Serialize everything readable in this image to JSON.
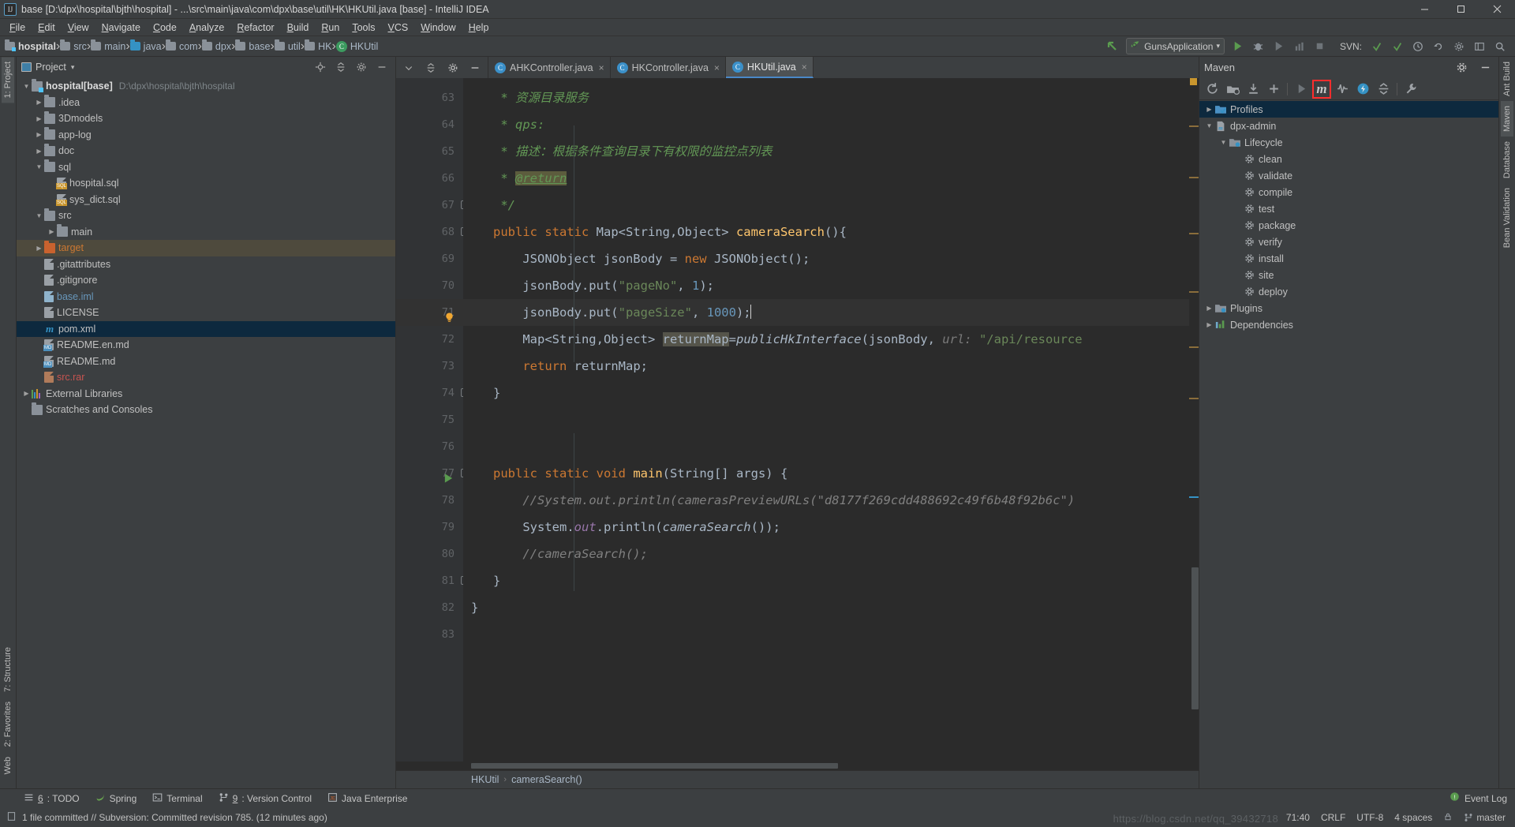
{
  "window": {
    "title": "base [D:\\dpx\\hospital\\bjth\\hospital] - ...\\src\\main\\java\\com\\dpx\\base\\util\\HK\\HKUtil.java [base] - IntelliJ IDEA",
    "logo": "IJ",
    "minimize_icon": "minimize-icon",
    "maximize_icon": "maximize-icon",
    "close_icon": "close-icon"
  },
  "menu": [
    "File",
    "Edit",
    "View",
    "Navigate",
    "Code",
    "Analyze",
    "Refactor",
    "Build",
    "Run",
    "Tools",
    "VCS",
    "Window",
    "Help"
  ],
  "breadcrumb": {
    "items": [
      "hospital",
      "src",
      "main",
      "java",
      "com",
      "dpx",
      "base",
      "util",
      "HK",
      "HKUtil"
    ],
    "separator": "›"
  },
  "toolbar": {
    "back_icon": "back-arrow-icon",
    "run_config": "GunsApplication",
    "run_config_caret": "▾",
    "run_icon": "run-icon",
    "debug_icon": "debug-icon",
    "coverage_icon": "run-with-coverage-icon",
    "profiler_icon": "profiler-icon",
    "stop_icon": "stop-icon",
    "svn_label": "SVN:",
    "svn_update_icon": "svn-update-icon",
    "svn_commit_icon": "svn-commit-icon",
    "history_icon": "history-icon",
    "rollback_icon": "rollback-icon",
    "settings_icon": "settings-icon",
    "layout_icon": "layout-icon",
    "search_icon": "search-icon"
  },
  "left_stripe": {
    "top": [
      {
        "label": "1: Project",
        "active": true
      }
    ],
    "bottom": [
      {
        "label": "7: Structure",
        "active": false
      },
      {
        "label": "2: Favorites",
        "active": false
      },
      {
        "label": "Web",
        "active": false
      }
    ]
  },
  "right_stripe": [
    {
      "label": "Ant Build",
      "active": false
    },
    {
      "label": "Maven",
      "active": true
    },
    {
      "label": "Database",
      "active": false
    },
    {
      "label": "Bean Validation",
      "active": false
    }
  ],
  "project_panel": {
    "title": "Project",
    "caret": "▾",
    "locate_icon": "locate-file-icon",
    "collapse_icon": "collapse-all-icon",
    "gear_icon": "gear-icon",
    "hide_icon": "hide-panel-icon",
    "tree": [
      {
        "depth": 0,
        "arrow": "▼",
        "icon": "folder-module",
        "name": "hospital",
        "bold_suffix": "[base]",
        "path": "D:\\dpx\\hospital\\bjth\\hospital",
        "style": "bold"
      },
      {
        "depth": 1,
        "arrow": "▶",
        "icon": "folder",
        "name": ".idea",
        "style": ""
      },
      {
        "depth": 1,
        "arrow": "▶",
        "icon": "folder",
        "name": "3Dmodels",
        "style": ""
      },
      {
        "depth": 1,
        "arrow": "▶",
        "icon": "folder",
        "name": "app-log",
        "style": ""
      },
      {
        "depth": 1,
        "arrow": "▶",
        "icon": "folder",
        "name": "doc",
        "style": ""
      },
      {
        "depth": 1,
        "arrow": "▼",
        "icon": "folder",
        "name": "sql",
        "style": ""
      },
      {
        "depth": 2,
        "arrow": "",
        "icon": "sql-file",
        "name": "hospital.sql",
        "style": ""
      },
      {
        "depth": 2,
        "arrow": "",
        "icon": "sql-file",
        "name": "sys_dict.sql",
        "style": ""
      },
      {
        "depth": 1,
        "arrow": "▼",
        "icon": "folder",
        "name": "src",
        "style": ""
      },
      {
        "depth": 2,
        "arrow": "▶",
        "icon": "folder",
        "name": "main",
        "style": ""
      },
      {
        "depth": 1,
        "arrow": "▶",
        "icon": "folder-orange",
        "name": "target",
        "style": "orange",
        "row": "highlight"
      },
      {
        "depth": 1,
        "arrow": "",
        "icon": "file",
        "name": ".gitattributes",
        "style": ""
      },
      {
        "depth": 1,
        "arrow": "",
        "icon": "file",
        "name": ".gitignore",
        "style": ""
      },
      {
        "depth": 1,
        "arrow": "",
        "icon": "iml-file",
        "name": "base.iml",
        "style": "blue"
      },
      {
        "depth": 1,
        "arrow": "",
        "icon": "file",
        "name": "LICENSE",
        "style": ""
      },
      {
        "depth": 1,
        "arrow": "",
        "icon": "maven-file",
        "name": "pom.xml",
        "style": "",
        "row": "selected"
      },
      {
        "depth": 1,
        "arrow": "",
        "icon": "md-file",
        "name": "README.en.md",
        "style": ""
      },
      {
        "depth": 1,
        "arrow": "",
        "icon": "md-file",
        "name": "README.md",
        "style": ""
      },
      {
        "depth": 1,
        "arrow": "",
        "icon": "rar-file",
        "name": "src.rar",
        "style": "red"
      },
      {
        "depth": 0,
        "arrow": "▶",
        "icon": "libraries",
        "name": "External Libraries",
        "style": ""
      },
      {
        "depth": 0,
        "arrow": "",
        "icon": "scratches",
        "name": "Scratches and Consoles",
        "style": ""
      }
    ]
  },
  "editor": {
    "tabs": [
      {
        "label": "AHKController.java",
        "active": false,
        "close": "×"
      },
      {
        "label": "HKController.java",
        "active": false,
        "close": "×"
      },
      {
        "label": "HKUtil.java",
        "active": true,
        "close": "×"
      }
    ],
    "tab_icon": "java-class-icon",
    "left_actions": [
      "expand-icon",
      "settings-icon",
      "hide-icon"
    ],
    "first_line_number": 63,
    "lines": [
      {
        "n": 63,
        "fold": "",
        "text": "    * 资源目录服务"
      },
      {
        "n": 64,
        "fold": "",
        "text": "    * qps:"
      },
      {
        "n": 65,
        "fold": "",
        "text": "    * 描述：根据条件查询目录下有权限的监控点列表"
      },
      {
        "n": 66,
        "fold": "",
        "text": "    * @return"
      },
      {
        "n": 67,
        "fold": "open",
        "text": "    */"
      },
      {
        "n": 68,
        "fold": "open",
        "text": "   public static Map<String,Object> cameraSearch(){"
      },
      {
        "n": 69,
        "fold": "",
        "text": "       JSONObject jsonBody = new JSONObject();"
      },
      {
        "n": 70,
        "fold": "",
        "text": "       jsonBody.put(\"pageNo\", 1);"
      },
      {
        "n": 71,
        "fold": "",
        "text": "       jsonBody.put(\"pageSize\", 1000);",
        "bulb": true,
        "current": true
      },
      {
        "n": 72,
        "fold": "",
        "text": "       Map<String,Object> returnMap=publicHkInterface(jsonBody, url: \"/api/resource"
      },
      {
        "n": 73,
        "fold": "",
        "text": "       return returnMap;"
      },
      {
        "n": 74,
        "fold": "open",
        "text": "   }"
      },
      {
        "n": 75,
        "fold": "",
        "text": ""
      },
      {
        "n": 76,
        "fold": "",
        "text": ""
      },
      {
        "n": 77,
        "fold": "open",
        "text": "   public static void main(String[] args) {",
        "run": true
      },
      {
        "n": 78,
        "fold": "",
        "text": "       //System.out.println(camerasPreviewURLs(\"d8177f269cdd488692c49f6b48f92b6c\")"
      },
      {
        "n": 79,
        "fold": "",
        "text": "       System.out.println(cameraSearch());"
      },
      {
        "n": 80,
        "fold": "",
        "text": "       //cameraSearch();"
      },
      {
        "n": 81,
        "fold": "open",
        "text": "   }"
      },
      {
        "n": 82,
        "fold": "",
        "text": "}"
      },
      {
        "n": 83,
        "fold": "",
        "text": ""
      }
    ],
    "footer_breadcrumb": [
      "HKUtil",
      "cameraSearch()"
    ],
    "footer_separator": "›"
  },
  "maven_panel": {
    "title": "Maven",
    "gear_icon": "gear-icon",
    "hide_icon": "hide-panel-icon",
    "toolbar": [
      {
        "name": "reimport-icon",
        "highlighted": false
      },
      {
        "name": "generate-sources-icon",
        "highlighted": false
      },
      {
        "name": "download-sources-icon",
        "highlighted": false
      },
      {
        "name": "add-maven-project-icon",
        "highlighted": false
      },
      {
        "name": "run-maven-build-icon",
        "highlighted": false
      },
      {
        "name": "execute-maven-goal-icon",
        "highlighted": true,
        "glyph": "m"
      },
      {
        "name": "toggle-skip-tests-icon",
        "highlighted": false
      },
      {
        "name": "toggle-offline-icon",
        "highlighted": false
      },
      {
        "name": "collapse-all-icon",
        "highlighted": false
      },
      {
        "name": "maven-settings-icon",
        "highlighted": false
      }
    ],
    "tree": [
      {
        "depth": 0,
        "arrow": "▶",
        "icon": "profiles-icon",
        "label": "Profiles",
        "selected": true
      },
      {
        "depth": 0,
        "arrow": "▼",
        "icon": "maven-project-icon",
        "label": "dpx-admin"
      },
      {
        "depth": 1,
        "arrow": "▼",
        "icon": "lifecycle-folder-icon",
        "label": "Lifecycle"
      },
      {
        "depth": 2,
        "arrow": "",
        "icon": "goal-icon",
        "label": "clean"
      },
      {
        "depth": 2,
        "arrow": "",
        "icon": "goal-icon",
        "label": "validate"
      },
      {
        "depth": 2,
        "arrow": "",
        "icon": "goal-icon",
        "label": "compile"
      },
      {
        "depth": 2,
        "arrow": "",
        "icon": "goal-icon",
        "label": "test"
      },
      {
        "depth": 2,
        "arrow": "",
        "icon": "goal-icon",
        "label": "package"
      },
      {
        "depth": 2,
        "arrow": "",
        "icon": "goal-icon",
        "label": "verify"
      },
      {
        "depth": 2,
        "arrow": "",
        "icon": "goal-icon",
        "label": "install"
      },
      {
        "depth": 2,
        "arrow": "",
        "icon": "goal-icon",
        "label": "site"
      },
      {
        "depth": 2,
        "arrow": "",
        "icon": "goal-icon",
        "label": "deploy"
      },
      {
        "depth": 0,
        "arrow": "▶",
        "icon": "plugins-folder-icon",
        "label": "Plugins"
      },
      {
        "depth": 0,
        "arrow": "▶",
        "icon": "dependencies-folder-icon",
        "label": "Dependencies"
      }
    ]
  },
  "toolwindow_bar": [
    {
      "icon": "todo-icon",
      "num": "6",
      "label": ": TODO"
    },
    {
      "icon": "spring-icon",
      "num": "",
      "label": "Spring"
    },
    {
      "icon": "terminal-icon",
      "num": "",
      "label": "Terminal"
    },
    {
      "icon": "version-control-icon",
      "num": "9",
      "label": ": Version Control"
    },
    {
      "icon": "java-enterprise-icon",
      "num": "",
      "label": "Java Enterprise"
    }
  ],
  "event_log": {
    "icon": "event-log-icon",
    "label": "Event Log"
  },
  "statusbar": {
    "icon": "vcs-status-icon",
    "message": "1 file committed // Subversion: Committed revision 785. (12 minutes ago)",
    "caret_position": "71:40",
    "line_sep": "CRLF",
    "encoding": "UTF-8",
    "indent": "4 spaces",
    "branch_icon": "branch-icon",
    "branch": "master",
    "lock_icon": "lock-icon"
  },
  "watermark": "https://blog.csdn.net/qq_39432718",
  "colors": {
    "bg_panel": "#3c3f41",
    "bg_editor": "#2b2b2b",
    "bg_gutter": "#313335",
    "selection": "#0d293e",
    "accent_blue": "#3592c4",
    "keyword_orange": "#cc7832",
    "string_green": "#6a8759",
    "comment_green": "#629755",
    "number_blue": "#6897bb",
    "highlight_red": "#ff2d2d"
  }
}
